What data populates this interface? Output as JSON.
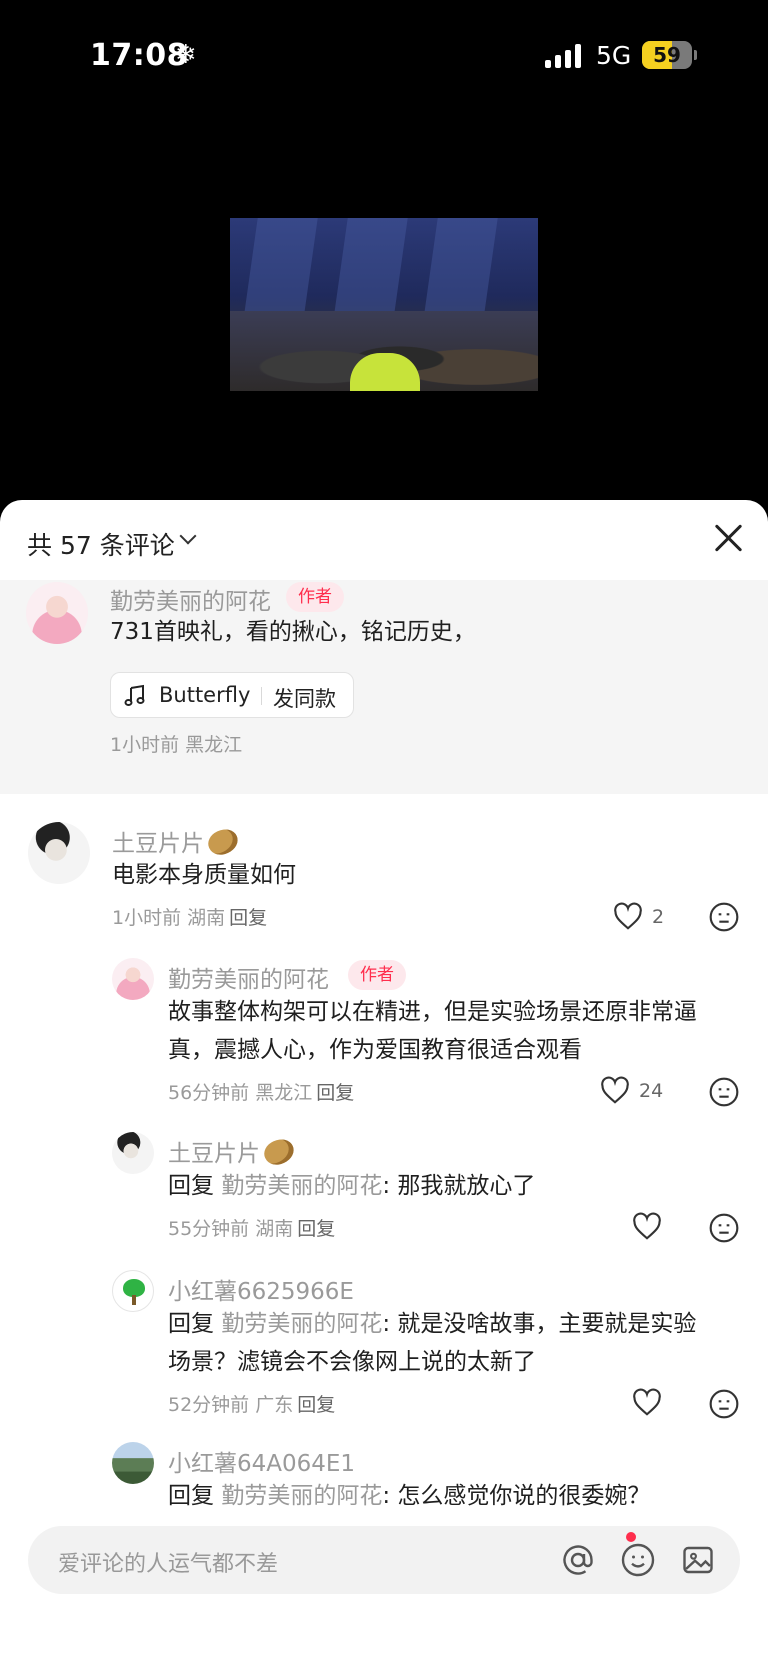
{
  "status_bar": {
    "time": "17:08",
    "snow_icon": "snowflake-icon",
    "network": "5G",
    "battery": "59",
    "battery_level": 0.59,
    "battery_color": "#f5d020"
  },
  "video": {
    "description_icon": "video-thumbnail"
  },
  "header": {
    "comment_count": "共 57 条评论"
  },
  "pinned": {
    "name": "勤劳美丽的阿花",
    "tag": "作者",
    "text": "731首映礼，看的揪心，铭记历史，",
    "music": {
      "label": "Butterfly",
      "action": "发同款"
    },
    "meta": "1小时前  黑龙江"
  },
  "comments": [
    {
      "name": "土豆片片",
      "text": "电影本身质量如何",
      "meta": "1小时前  湖南",
      "reply_label": "回复",
      "likes": "2"
    }
  ],
  "replies": [
    {
      "name": "勤劳美丽的阿花",
      "tag": "作者",
      "text_line1": "故事整体构架可以在精进，但是实验场景还原非常逼",
      "text_line2": "真，震撼人心，作为爱国教育很适合观看",
      "meta": "56分钟前  黑龙江",
      "reply_label": "回复",
      "likes": "24"
    },
    {
      "name": "土豆片片",
      "prefix": "回复 ",
      "target": "勤劳美丽的阿花",
      "text": ": 那我就放心了",
      "meta": "55分钟前  湖南",
      "reply_label": "回复"
    },
    {
      "name": "小红薯6625966E",
      "prefix": "回复 ",
      "target": "勤劳美丽的阿花",
      "text_line1": ": 就是没啥故事，主要就是实验",
      "text_line2": "场景？滤镜会不会像网上说的太新了",
      "meta": "52分钟前  广东",
      "reply_label": "回复"
    },
    {
      "name": "小红薯64A064E1",
      "prefix": "回复 ",
      "target": "勤劳美丽的阿花",
      "text": ": 怎么感觉你说的很委婉？"
    }
  ],
  "input": {
    "placeholder": "爱评论的人运气都不差"
  },
  "colors": {
    "accent": "#ff2e4d",
    "author_tag_bg": "#fde8ec"
  }
}
